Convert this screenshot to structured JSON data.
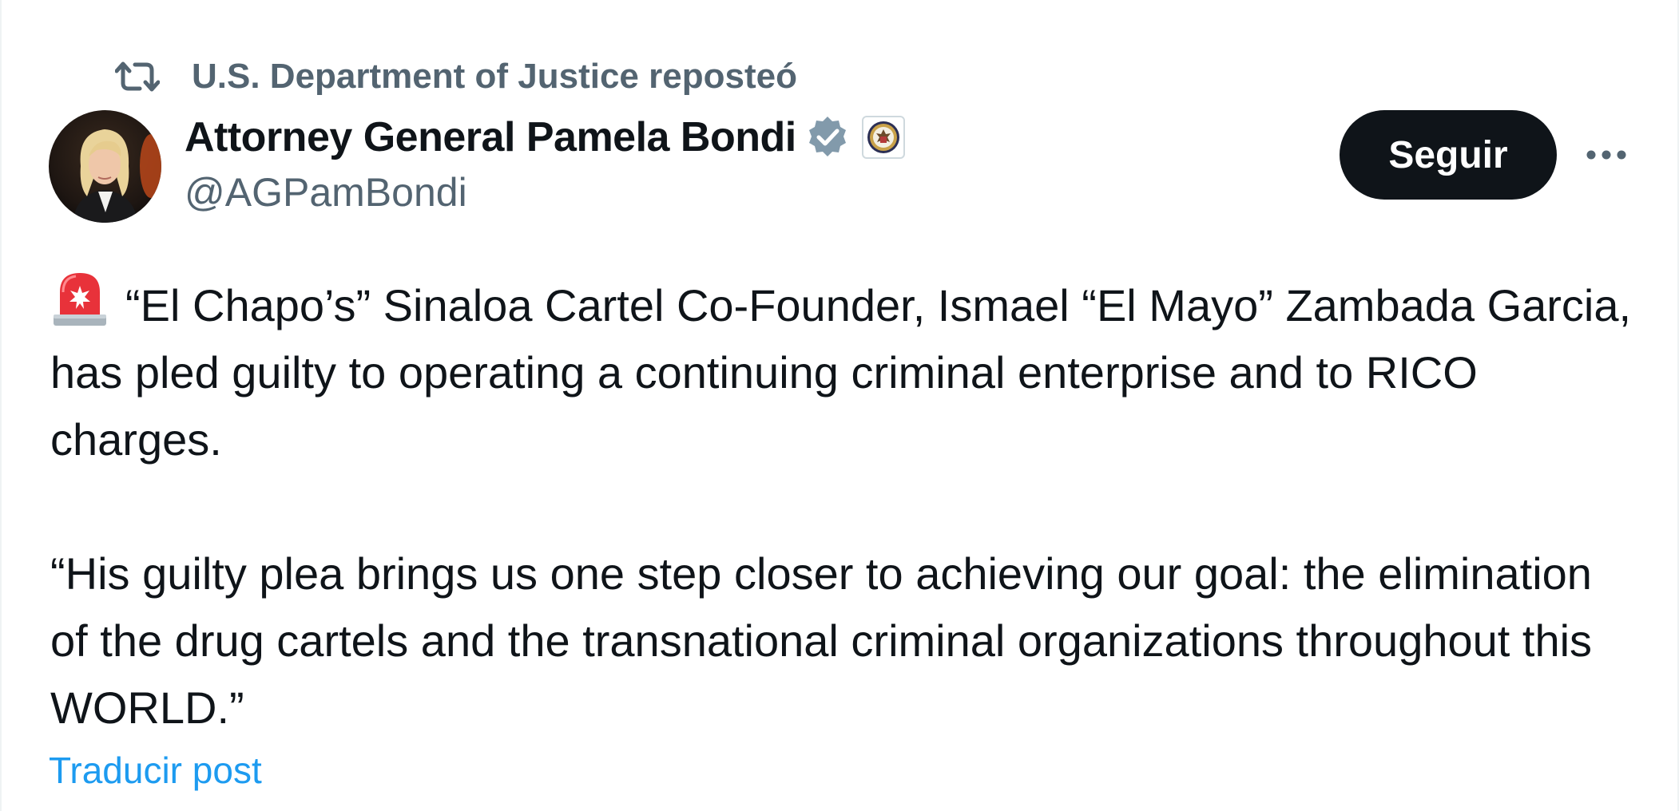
{
  "repost": {
    "icon": "repost-icon",
    "text": "U.S. Department of Justice reposteó"
  },
  "author": {
    "avatar": "avatar",
    "display_name": "Attorney General Pamela Bondi",
    "verified_icon": "verified-badge-icon",
    "affiliate_badge": "doj-seal-icon",
    "handle": "@AGPamBondi"
  },
  "actions": {
    "follow_label": "Seguir",
    "more_icon": "more-options-icon"
  },
  "tweet": {
    "emoji_icon": "police-siren-icon",
    "paragraph_1": "“El Chapo’s” Sinaloa Cartel Co-Founder, Ismael “El Mayo” Zambada Garcia, has pled guilty to operating a continuing criminal enterprise and to RICO charges.",
    "paragraph_2": "“His guilty plea brings us one step closer to achieving our goal: the elimination of the drug cartels and the transnational criminal organizations throughout this WORLD.”"
  },
  "translate_label": "Traducir post",
  "colors": {
    "text_primary": "#0f1419",
    "text_secondary": "#536471",
    "link": "#1d9bf0",
    "follow_bg": "#0f1419",
    "verified": "#829aab",
    "siren": "#e8323a"
  }
}
